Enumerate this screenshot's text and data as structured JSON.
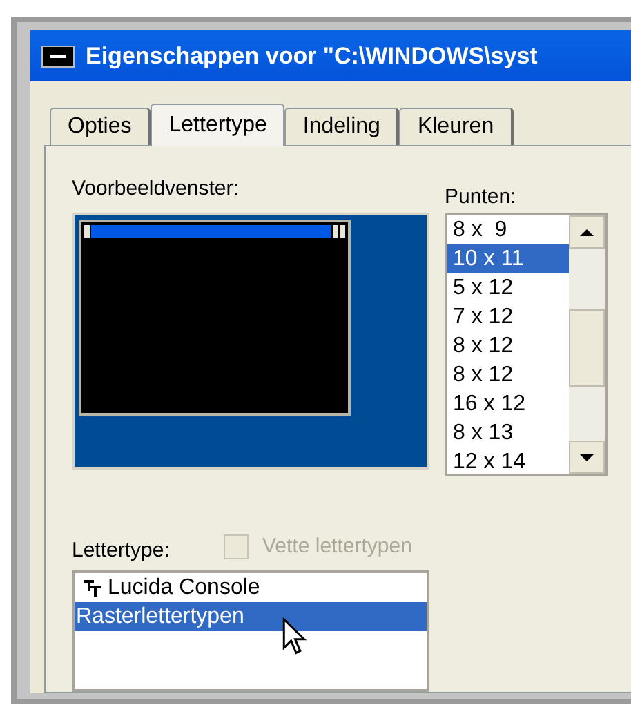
{
  "window": {
    "title": "Eigenschappen voor \"C:\\WINDOWS\\syst"
  },
  "tabs": [
    {
      "label": "Opties",
      "selected": false
    },
    {
      "label": "Lettertype",
      "selected": true
    },
    {
      "label": "Indeling",
      "selected": false
    },
    {
      "label": "Kleuren",
      "selected": false
    }
  ],
  "preview": {
    "label": "Voorbeeldvenster:"
  },
  "sizes": {
    "label": "Punten:",
    "items": [
      {
        "label": "8 x  9",
        "selected": false
      },
      {
        "label": "10 x 11",
        "selected": true
      },
      {
        "label": "5 x 12",
        "selected": false
      },
      {
        "label": "7 x 12",
        "selected": false
      },
      {
        "label": "8 x 12",
        "selected": false
      },
      {
        "label": "8 x 12",
        "selected": false
      },
      {
        "label": "16 x 12",
        "selected": false
      },
      {
        "label": "8 x 13",
        "selected": false
      },
      {
        "label": "12 x 14",
        "selected": false
      }
    ]
  },
  "font": {
    "label": "Lettertype:",
    "bold_checkbox": {
      "label": "Vette lettertypen",
      "checked": false,
      "disabled": true
    },
    "items": [
      {
        "label": "Lucida Console",
        "kind": "truetype",
        "selected": false
      },
      {
        "label": "Rasterlettertypen",
        "kind": "raster",
        "selected": true
      }
    ]
  }
}
